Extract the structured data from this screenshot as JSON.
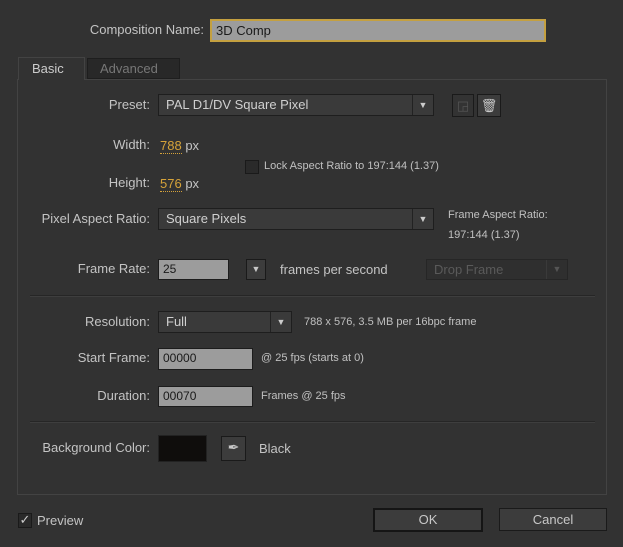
{
  "composition_name": {
    "label": "Composition Name:",
    "value": "3D Comp"
  },
  "tabs": [
    {
      "label": "Basic",
      "active": true
    },
    {
      "label": "Advanced",
      "active": false
    }
  ],
  "preset": {
    "label": "Preset:",
    "value": "PAL D1/DV Square Pixel"
  },
  "width": {
    "label": "Width:",
    "value": "788",
    "unit": "px"
  },
  "height": {
    "label": "Height:",
    "value": "576",
    "unit": "px"
  },
  "lock_aspect": {
    "label": "Lock Aspect Ratio to 197:144 (1.37)",
    "checked": false
  },
  "pixel_aspect": {
    "label": "Pixel Aspect Ratio:",
    "value": "Square Pixels"
  },
  "frame_aspect": {
    "label": "Frame Aspect Ratio:",
    "value": "197:144 (1.37)"
  },
  "frame_rate": {
    "label": "Frame Rate:",
    "value": "25",
    "unit": "frames per second",
    "drop_frame": "Drop Frame"
  },
  "resolution": {
    "label": "Resolution:",
    "value": "Full",
    "info": "788 x 576, 3.5 MB per 16bpc frame"
  },
  "start_frame": {
    "label": "Start Frame:",
    "value": "00000",
    "info": "@ 25 fps (starts at 0)"
  },
  "duration": {
    "label": "Duration:",
    "value": "00070",
    "info": "Frames @ 25 fps"
  },
  "background": {
    "label": "Background Color:",
    "color": "#0f0d0c",
    "name": "Black"
  },
  "preview": {
    "label": "Preview",
    "checked": true
  },
  "buttons": {
    "ok": "OK",
    "cancel": "Cancel"
  }
}
